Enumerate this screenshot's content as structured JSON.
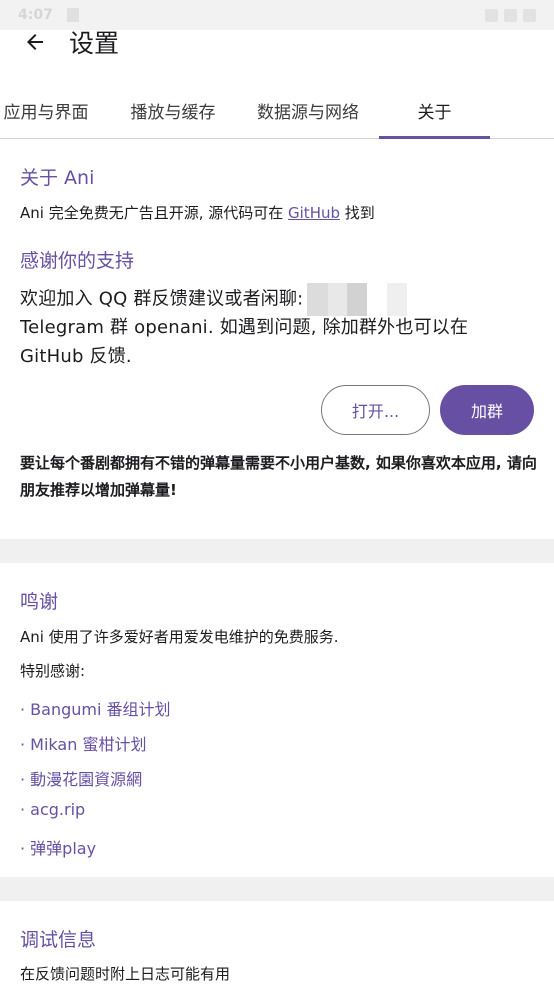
{
  "status_bar": {
    "time": "4:07"
  },
  "header": {
    "title": "设置"
  },
  "tabs": [
    {
      "label": "应用与界面"
    },
    {
      "label": "播放与缓存"
    },
    {
      "label": "数据源与网络"
    },
    {
      "label": "关于"
    }
  ],
  "about": {
    "title": "关于 Ani",
    "desc_prefix": "Ani 完全免费无广告且开源, 源代码可在 ",
    "desc_link": "GitHub",
    "desc_suffix": " 找到",
    "support_title": "感谢你的支持",
    "join_line": "欢迎加入 QQ 群反馈建议或者闲聊:",
    "telegram_line1": "Telegram 群 openani. 如遇到问题, 除加群外也可以在",
    "telegram_line2": "GitHub 反馈.",
    "open_button": "打开...",
    "join_button": "加群",
    "recommend": "要让每个番剧都拥有不错的弹幕量需要不小用户基数, 如果你喜欢本应用, 请向朋友推荐以增加弹幕量!"
  },
  "credits": {
    "title": "鸣谢",
    "desc": "Ani 使用了许多爱好者用爱发电维护的免费服务.",
    "special": "特别感谢:",
    "items": [
      "· Bangumi 番组计划",
      "· Mikan 蜜柑计划",
      "· 動漫花園資源網",
      "· acg.rip",
      "· 弹弹play"
    ]
  },
  "debug": {
    "title": "调试信息",
    "desc": "在反馈问题时附上日志可能有用"
  },
  "colors": {
    "accent": "#6750a4",
    "divider_band": "#f0f0f0"
  }
}
